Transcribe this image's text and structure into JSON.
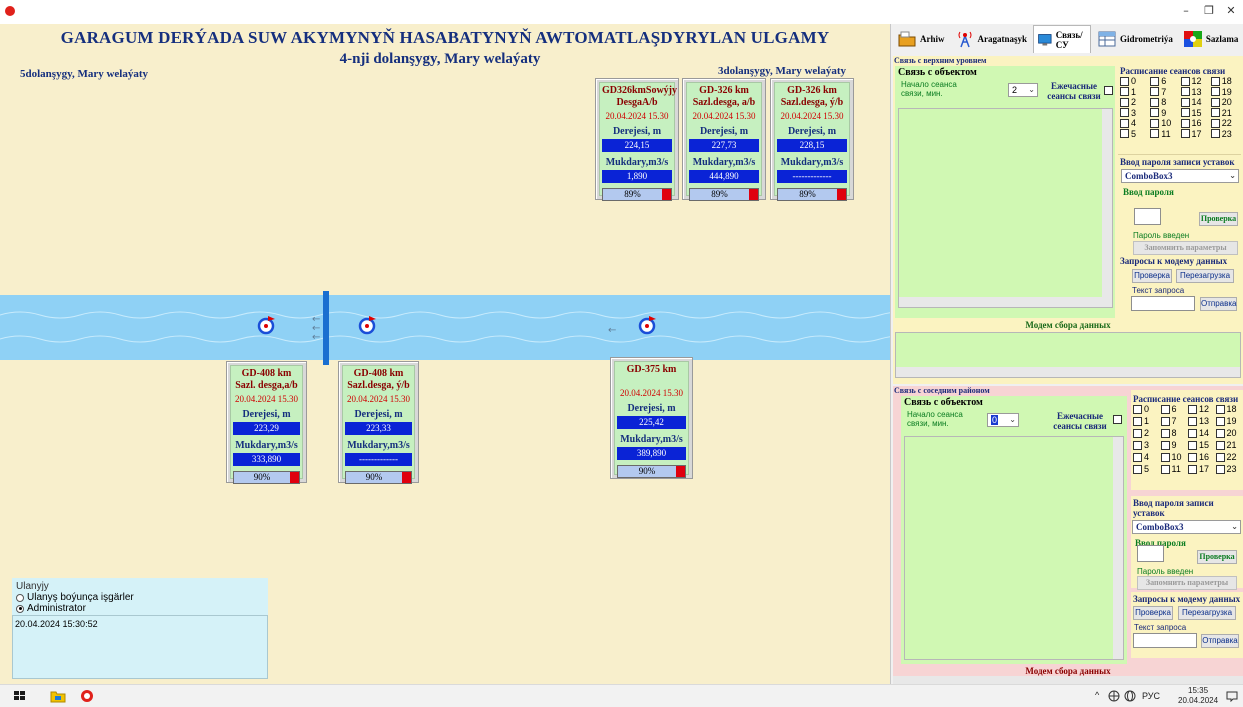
{
  "window": {
    "minimize": "–",
    "maximize": "❐",
    "close": "✕"
  },
  "dashboard": {
    "title": "GARAGUM DERÝADA SUW AKYMYNYŇ  HASABATYNYŇ AWTOMATLAŞDYRYLAN ULGAMY",
    "subtitle": "4-nji dolanşygy, Mary welaýaty",
    "region_left": "5dolanşygy, Mary welaýaty",
    "region_right": "3dolanşygy, Mary welaýaty",
    "stations_top": [
      {
        "title": "GD326kmSowýjy DesgaA/b",
        "date": "20.04.2024  15.30",
        "level_label": "Derejesi, m",
        "level": "224,15",
        "flow_label": "Mukdary,m3/s",
        "flow": "1,890",
        "percent": "89%"
      },
      {
        "title": "GD-326 km Sazl.desga, a/b",
        "date": "20.04.2024  15.30",
        "level_label": "Derejesi, m",
        "level": "227,73",
        "flow_label": "Mukdary,m3/s",
        "flow": "444,890",
        "percent": "89%"
      },
      {
        "title": "GD-326 km Sazl.desga, ý/b",
        "date": "20.04.2024  15.30",
        "level_label": "Derejesi, m",
        "level": "228,15",
        "flow_label": "Mukdary,m3/s",
        "flow": "-------------",
        "percent": "89%"
      }
    ],
    "stations_bottom": [
      {
        "title": "GD-408 km Sazl. desga,a/b",
        "date": "20.04.2024  15.30",
        "level_label": "Derejesi, m",
        "level": "223,29",
        "flow_label": "Mukdary,m3/s",
        "flow": "333,890",
        "percent": "90%"
      },
      {
        "title": "GD-408 km Sazl.desga, ý/b",
        "date": "20.04.2024  15.30",
        "level_label": "Derejesi, m",
        "level": "223,33",
        "flow_label": "Mukdary,m3/s",
        "flow": "-------------",
        "percent": "90%"
      },
      {
        "title": "GD-375 km",
        "date": "20.04.2024  15.30",
        "level_label": "Derejesi, m",
        "level": "225,42",
        "flow_label": "Mukdary,m3/s",
        "flow": "389,890",
        "percent": "90%"
      }
    ],
    "arrows": {
      "left1": "←",
      "left2": "←",
      "left3": "←",
      "right": "←"
    },
    "user": {
      "heading": "Ulanyjy",
      "option1": "Ulanyş boýunça işgärler",
      "option2": "Administrator",
      "selected": "Administrator"
    },
    "log": "20.04.2024 15:30:52"
  },
  "tabs": [
    {
      "label": "Arhiw",
      "icon": "archive-icon"
    },
    {
      "label": "Aragatnaşyk",
      "icon": "antenna-icon"
    },
    {
      "label": "Связь/СУ",
      "icon": "monitor-icon",
      "active": true
    },
    {
      "label": "Gidrometriýa",
      "icon": "table-icon"
    },
    {
      "label": "Sazlama",
      "icon": "palette-icon"
    }
  ],
  "upper": {
    "section_title": "Связь с верхним уровнем",
    "object_title": "Связь с объектом",
    "session_start_label": "Начало сеанса связи, мин.",
    "session_start_value": "2",
    "hourly_label": "Ежечасные сеансы связи",
    "schedule_title": "Расписание сеансов связи",
    "password_title": "Ввод пароля записи уставок",
    "combo": "ComboBox3",
    "password_label": "Ввод пароля",
    "check_button": "Проверка",
    "password_status": "Пароль введен",
    "save_button": "Запомнить параметры",
    "modem_title": "Запросы к модему данных",
    "modem_check": "Проверка",
    "modem_reboot": "Перезагрузка",
    "request_label": "Текст запроса",
    "send_button": "Отправка",
    "collector_title": "Модем сбора данных"
  },
  "lower": {
    "section_title": "Связь с соседним районом",
    "object_title": "Связь с объектом",
    "session_start_label": "Начало сеанса связи, мин.",
    "session_start_value": "0",
    "hourly_label": "Ежечасные сеансы связи",
    "schedule_title": "Расписание сеансов связи",
    "password_title": "Ввод пароля записи уставок",
    "combo": "ComboBox3",
    "password_label": "Ввод пароля",
    "check_button": "Проверка",
    "password_status": "Пароль введен",
    "save_button": "Запомнить параметры",
    "modem_title": "Запросы к модему данных",
    "modem_check": "Проверка",
    "modem_reboot": "Перезагрузка",
    "request_label": "Текст запроса",
    "send_button": "Отправка",
    "collector_title": "Модем сбора данных"
  },
  "taskbar": {
    "lang": "РУС",
    "time": "15:35",
    "date": "20.04.2024",
    "tray": "^"
  },
  "colors": {
    "accent": "#0a23d6",
    "title": "#152f7e",
    "river": "#8fd1f5",
    "panel_green": "#d0f8b3",
    "panel_yellow": "#fbf3c1"
  }
}
